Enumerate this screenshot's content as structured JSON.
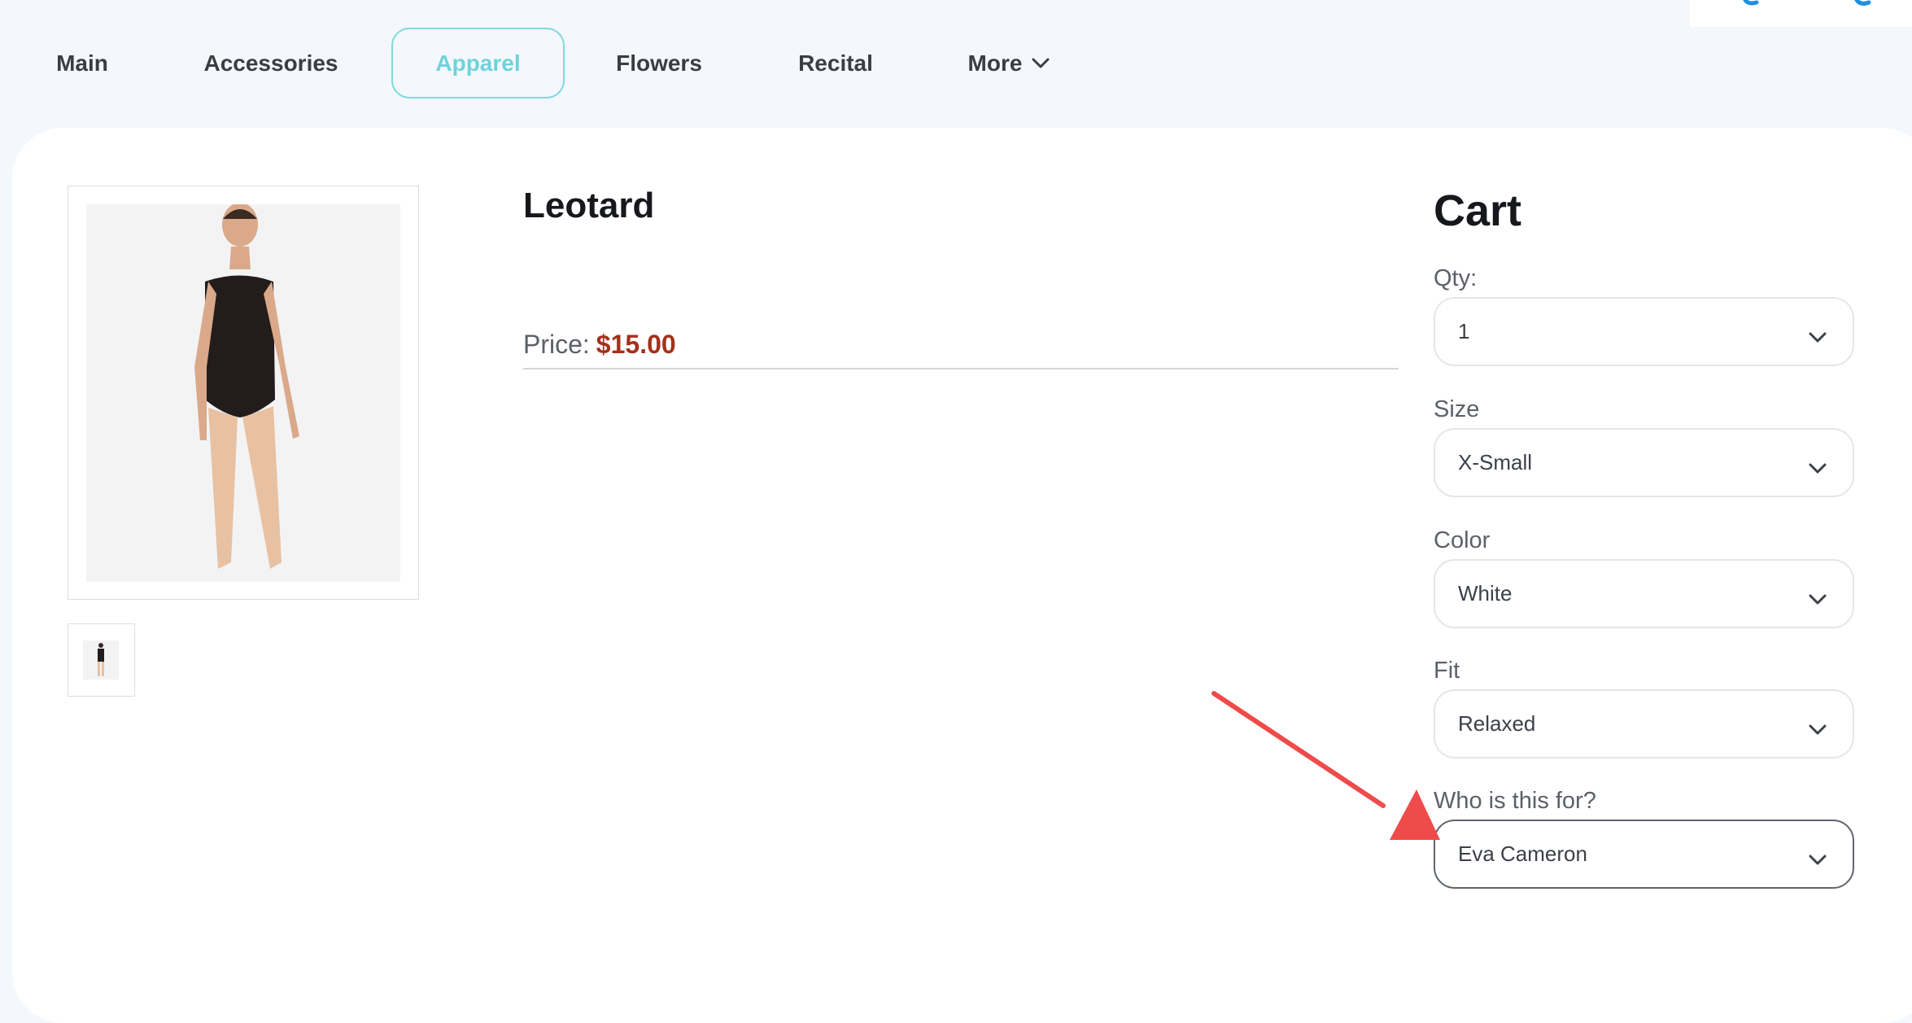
{
  "nav": {
    "items": [
      {
        "label": "Main"
      },
      {
        "label": "Accessories"
      },
      {
        "label": "Apparel",
        "active": true
      },
      {
        "label": "Flowers"
      },
      {
        "label": "Recital"
      },
      {
        "label": "More",
        "icon": "chevron-down-icon"
      }
    ]
  },
  "product": {
    "title": "Leotard",
    "price_label": "Price:",
    "price_value": "$15.00",
    "image": "leotard-photo",
    "thumbnail": "leotard-thumbnail"
  },
  "cart": {
    "title": "Cart",
    "fields": [
      {
        "label": "Qty:",
        "value": "1"
      },
      {
        "label": "Size",
        "value": "X-Small"
      },
      {
        "label": "Color",
        "value": "White"
      },
      {
        "label": "Fit",
        "value": "Relaxed"
      },
      {
        "label": "Who is this for?",
        "value": "Eva Cameron",
        "focused": true
      }
    ]
  },
  "colors": {
    "active_tab": "#6fd3da",
    "price": "#a3311a",
    "annotation_arrow": "#ef4b4b"
  }
}
